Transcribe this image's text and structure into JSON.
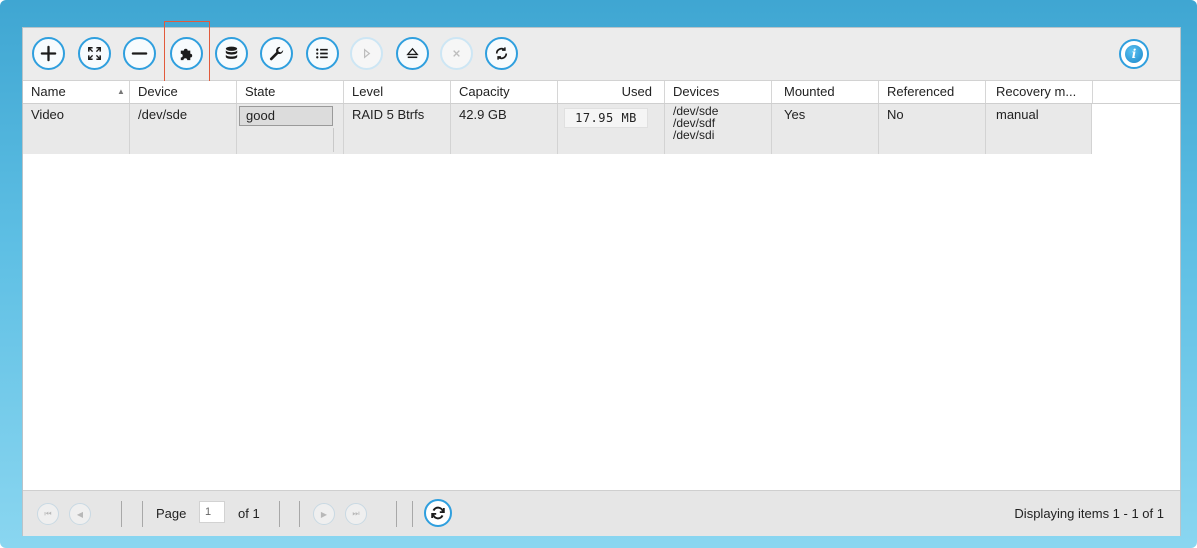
{
  "toolbar": {
    "buttons": [
      {
        "name": "add-icon",
        "enabled": true
      },
      {
        "name": "expand-icon",
        "enabled": true
      },
      {
        "name": "remove-icon",
        "enabled": true
      },
      {
        "name": "puzzle-icon",
        "enabled": true,
        "highlighted": true
      },
      {
        "name": "database-icon",
        "enabled": true
      },
      {
        "name": "wrench-icon",
        "enabled": true
      },
      {
        "name": "list-icon",
        "enabled": true
      },
      {
        "name": "play-icon",
        "enabled": false
      },
      {
        "name": "eject-icon",
        "enabled": true
      },
      {
        "name": "close-icon",
        "enabled": false
      },
      {
        "name": "circle-arrows-icon",
        "enabled": true
      }
    ],
    "info_icon": "info-icon",
    "info_glyph": "i"
  },
  "table": {
    "columns": [
      "Name",
      "Device",
      "State",
      "Level",
      "Capacity",
      "Used",
      "Devices",
      "Mounted",
      "Referenced",
      "Recovery m..."
    ],
    "sort_indicator": "▲",
    "rows": [
      {
        "name": "Video",
        "device": "/dev/sde",
        "state": "good",
        "level": "RAID 5 Btrfs",
        "capacity": "42.9 GB",
        "used": "17.95 MB",
        "devices": [
          "/dev/sde",
          "/dev/sdf",
          "/dev/sdi"
        ],
        "mounted": "Yes",
        "referenced": "No",
        "recovery": "manual"
      }
    ]
  },
  "pager": {
    "first_glyph": "⏮",
    "prev_glyph": "◀",
    "next_glyph": "▶",
    "last_glyph": "⏭",
    "page_label": "Page",
    "page_value": "1",
    "of_label": "of 1",
    "display_info": "Displaying items 1 - 1 of 1"
  },
  "colors": {
    "accent": "#2f9fde",
    "highlight": "#e25a3c"
  }
}
